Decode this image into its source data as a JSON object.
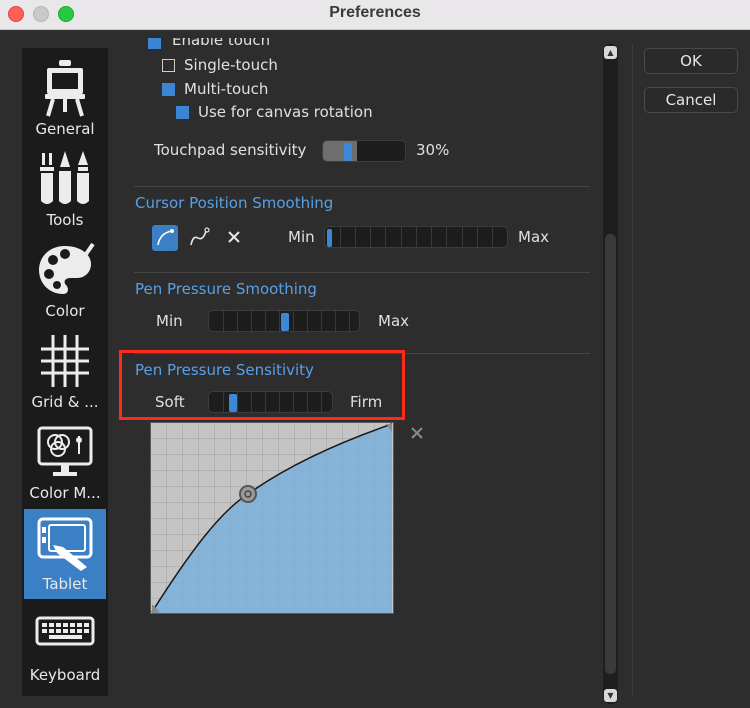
{
  "window": {
    "title": "Preferences"
  },
  "sidebar": {
    "items": [
      {
        "label": "General",
        "icon": "easel-icon",
        "active": false
      },
      {
        "label": "Tools",
        "icon": "brushes-icon",
        "active": false
      },
      {
        "label": "Color",
        "icon": "palette-icon",
        "active": false
      },
      {
        "label": "Grid & ...",
        "icon": "grid-icon",
        "active": false
      },
      {
        "label": "Color M...",
        "icon": "color-management-icon",
        "active": false
      },
      {
        "label": "Tablet",
        "icon": "tablet-pen-icon",
        "active": true
      },
      {
        "label": "Keyboard",
        "icon": "keyboard-icon",
        "active": false
      }
    ]
  },
  "touch": {
    "enable_touch_label": "Enable touch",
    "single_touch_label": "Single-touch",
    "multi_touch_label": "Multi-touch",
    "canvas_rotation_label": "Use for canvas rotation",
    "touchpad_sensitivity_label": "Touchpad sensitivity",
    "touchpad_sensitivity_value": "30%",
    "enable_touch_checked": true,
    "single_touch_checked": false,
    "multi_touch_checked": true,
    "canvas_rotation_checked": true
  },
  "cursor_smoothing": {
    "title": "Cursor Position Smoothing",
    "min_label": "Min",
    "max_label": "Max",
    "level": 0.0,
    "modes": [
      "curve-smoothing-icon",
      "path-smoothing-icon",
      "close-icon"
    ]
  },
  "pen_smoothing": {
    "title": "Pen Pressure Smoothing",
    "min_label": "Min",
    "max_label": "Max",
    "level": 0.5
  },
  "pen_sensitivity": {
    "title": "Pen Pressure Sensitivity",
    "soft_label": "Soft",
    "firm_label": "Firm",
    "level": 0.2,
    "curve_reset_icon": "close-icon"
  },
  "buttons": {
    "ok": "OK",
    "cancel": "Cancel"
  },
  "colors": {
    "accent": "#3b7fc4",
    "section_title": "#58a0e6",
    "highlight": "#ff2a1a",
    "curve_fill": "#7fb2dc"
  }
}
